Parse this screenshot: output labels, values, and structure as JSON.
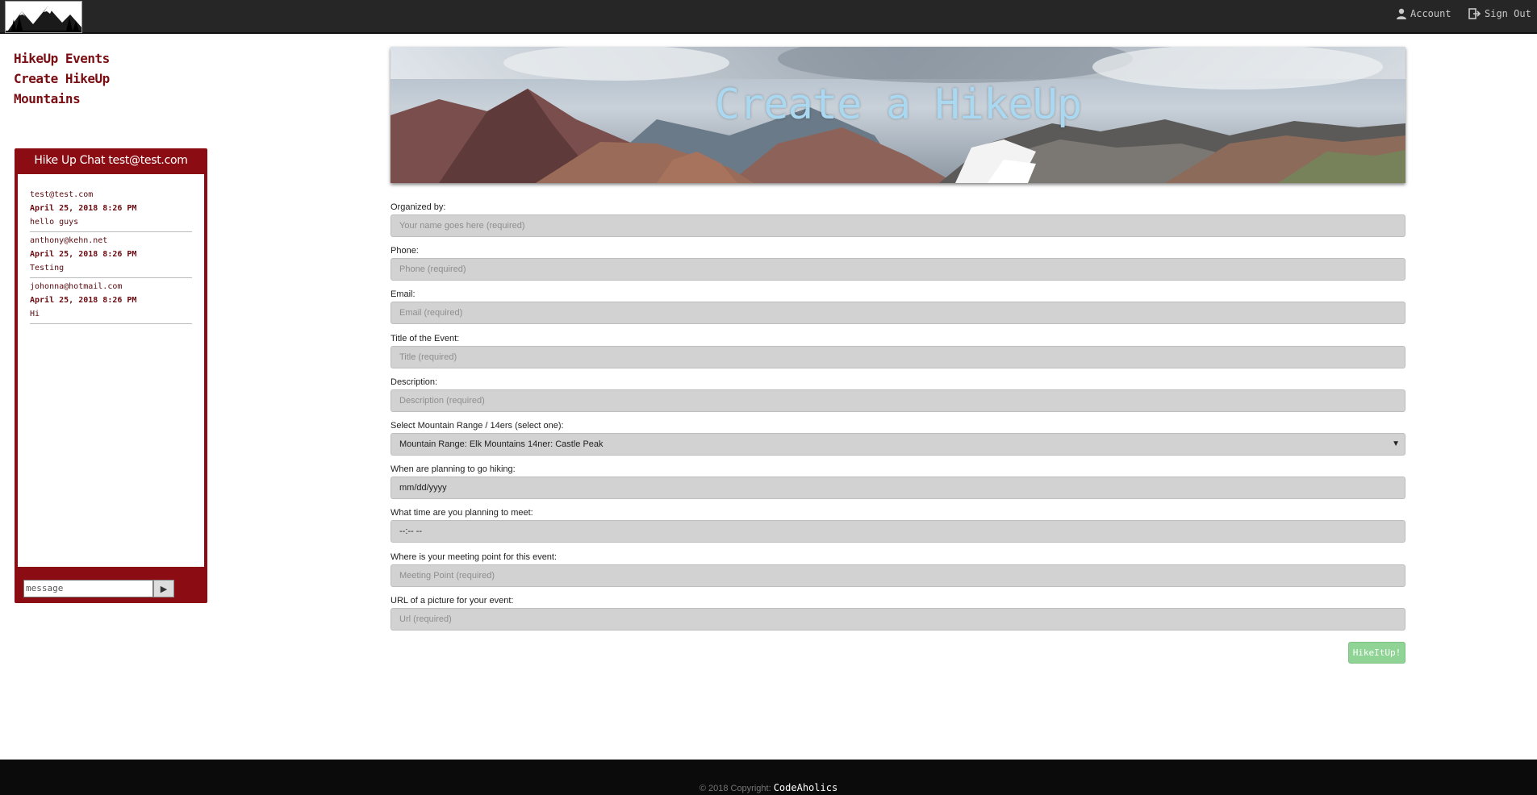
{
  "header": {
    "account_label": "Account",
    "signout_label": "Sign Out"
  },
  "nav": {
    "items": [
      {
        "label": "HikeUp Events"
      },
      {
        "label": "Create HikeUp"
      },
      {
        "label": "Mountains"
      }
    ]
  },
  "chat": {
    "title": "Hike Up Chat test@test.com",
    "messages": [
      {
        "user": "test@test.com",
        "date": "April 25, 2018 8:26 PM",
        "text": "hello guys"
      },
      {
        "user": "anthony@kehn.net",
        "date": "April 25, 2018 8:26 PM",
        "text": "Testing"
      },
      {
        "user": "johonna@hotmail.com",
        "date": "April 25, 2018 8:26 PM",
        "text": "Hi"
      }
    ],
    "input_placeholder": "message",
    "send_icon": "play-icon"
  },
  "banner": {
    "title": "Create a HikeUp"
  },
  "form": {
    "organized_by": {
      "label": "Organized by:",
      "placeholder": "Your name goes here (required)"
    },
    "phone": {
      "label": "Phone:",
      "placeholder": "Phone (required)"
    },
    "email": {
      "label": "Email:",
      "placeholder": "Email (required)"
    },
    "title": {
      "label": "Title of the Event:",
      "placeholder": "Title (required)"
    },
    "description": {
      "label": "Description:",
      "placeholder": "Description (required)"
    },
    "mountain": {
      "label": "Select Mountain Range / 14ers (select one):",
      "value": "Mountain Range: Elk Mountains 14ner: Castle Peak"
    },
    "date": {
      "label": "When are planning to go hiking:",
      "value": "mm/dd/yyyy"
    },
    "time": {
      "label": "What time are you planning to meet:",
      "value": "--:-- --"
    },
    "meeting_point": {
      "label": "Where is your meeting point for this event:",
      "placeholder": "Meeting Point (required)"
    },
    "url": {
      "label": "URL of a picture for your event:",
      "placeholder": "Url (required)"
    },
    "submit_label": "HikeItUp!"
  },
  "footer": {
    "copyright": "© 2018 Copyright:",
    "brand": "CodeAholics"
  },
  "colors": {
    "accent": "#8b0c13",
    "topbar": "#262626",
    "submit": "#8fd494",
    "banner_title": "#a9d8f0"
  }
}
